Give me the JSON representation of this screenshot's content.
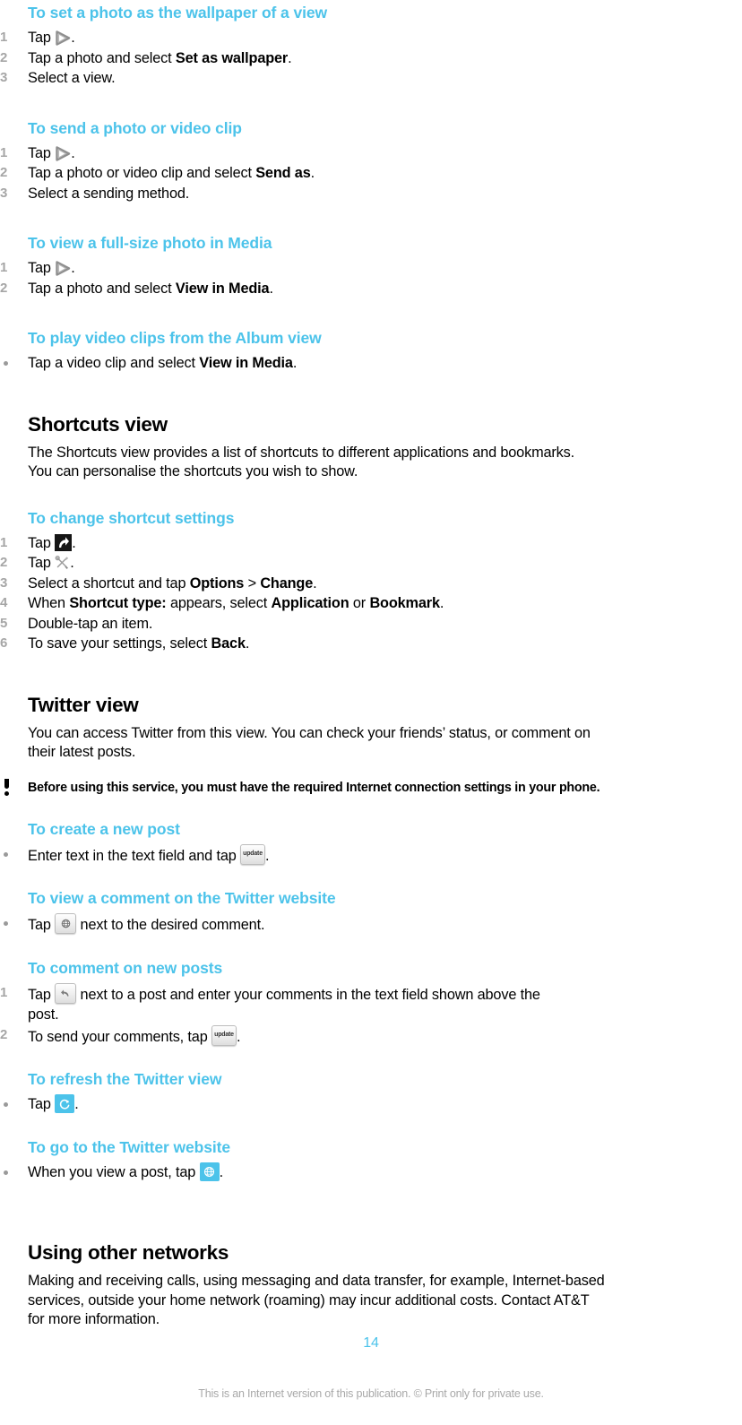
{
  "document": {
    "page_number": "14",
    "footer_note": "This is an Internet version of this publication. © Print only for private use.",
    "heading_color": "#4cc3ea",
    "body_color": "#000000",
    "marker_color": "#a6a6a6"
  },
  "sections": {
    "set_wallpaper": {
      "heading": "To set a photo as the wallpaper of a view",
      "steps": [
        {
          "num": "1",
          "pre": "Tap ",
          "icon": "play-icon",
          "post": "."
        },
        {
          "num": "2",
          "pre": "Tap a photo and select ",
          "bold": "Set as wallpaper",
          "post": "."
        },
        {
          "num": "3",
          "pre": "Select a view.",
          "post": ""
        }
      ]
    },
    "send_photo": {
      "heading": "To send a photo or video clip",
      "steps": [
        {
          "num": "1",
          "pre": "Tap ",
          "icon": "play-icon",
          "post": "."
        },
        {
          "num": "2",
          "pre": "Tap a photo or video clip and select ",
          "bold": "Send as",
          "post": "."
        },
        {
          "num": "3",
          "pre": "Select a sending method.",
          "post": ""
        }
      ]
    },
    "full_size_photo": {
      "heading": "To view a full-size photo in Media",
      "steps": [
        {
          "num": "1",
          "pre": "Tap ",
          "icon": "play-icon",
          "post": "."
        },
        {
          "num": "2",
          "pre": "Tap a photo and select ",
          "bold": "View in Media",
          "post": "."
        }
      ]
    },
    "play_video_clips": {
      "heading": "To play video clips from the Album view",
      "steps": [
        {
          "num": "•",
          "pre": "Tap a video clip and select ",
          "bold": "View in Media",
          "post": "."
        }
      ]
    },
    "shortcuts_view": {
      "heading": "Shortcuts view",
      "paragraph_line1": "The Shortcuts view provides a list of shortcuts to different applications and bookmarks.",
      "paragraph_line2": "You can personalise the shortcuts you wish to show."
    },
    "change_shortcut_settings": {
      "heading": "To change shortcut settings",
      "steps": [
        {
          "num": "1",
          "pre": "Tap ",
          "icon": "shortcut-icon",
          "post": "."
        },
        {
          "num": "2",
          "pre": "Tap ",
          "icon": "tools-icon",
          "post": "."
        },
        {
          "num": "3",
          "pre": "Select a shortcut and tap ",
          "bold": "Options",
          "mid": " > ",
          "bold2": "Change",
          "post": "."
        },
        {
          "num": "4",
          "pre": "When ",
          "bold": "Shortcut type:",
          "mid": " appears, select ",
          "bold2": "Application",
          "mid2": " or ",
          "bold3": "Bookmark",
          "post": "."
        },
        {
          "num": "5",
          "pre": "Double-tap an item.",
          "post": ""
        },
        {
          "num": "6",
          "pre": "To save your settings, select ",
          "bold": "Back",
          "post": "."
        }
      ]
    },
    "twitter_view": {
      "heading": "Twitter view",
      "paragraph_line1": "You can access Twitter from this view. You can check your friends’ status, or comment on",
      "paragraph_line2": "their latest posts.",
      "note": "Before using this service, you must have the required Internet connection settings in your phone."
    },
    "create_post": {
      "heading": "To create a new post",
      "steps": [
        {
          "num": "•",
          "pre": "Enter text in the text field and tap ",
          "icon": "update-key",
          "icon_label": "update",
          "post": "."
        }
      ]
    },
    "view_comment": {
      "heading": "To view a comment on the Twitter website",
      "steps": [
        {
          "num": "•",
          "pre": "Tap ",
          "icon": "globe-key",
          "post": " next to the desired comment."
        }
      ]
    },
    "comment_on_posts": {
      "heading": "To comment on new posts",
      "steps": [
        {
          "num": "1",
          "pre": "Tap ",
          "icon": "reply-key",
          "post": " next to a post and enter your comments in the text field shown above the",
          "wrap": "post."
        },
        {
          "num": "2",
          "pre": "To send your comments, tap ",
          "icon": "update-key",
          "icon_label": "update",
          "post": "."
        }
      ]
    },
    "refresh_twitter": {
      "heading": "To refresh the Twitter view",
      "steps": [
        {
          "num": "•",
          "pre": "Tap ",
          "icon": "refresh-blue-icon",
          "post": "."
        }
      ]
    },
    "go_twitter_website": {
      "heading": "To go to the Twitter website",
      "steps": [
        {
          "num": "•",
          "pre": "When you view a post, tap ",
          "icon": "globe-blue-icon",
          "post": "."
        }
      ]
    },
    "using_other_networks": {
      "heading": "Using other networks",
      "paragraph_line1": "Making and receiving calls, using messaging and data transfer, for example, Internet-based",
      "paragraph_line2": "services, outside your home network (roaming) may incur additional costs. Contact AT&T",
      "paragraph_line3": "for more information."
    }
  }
}
